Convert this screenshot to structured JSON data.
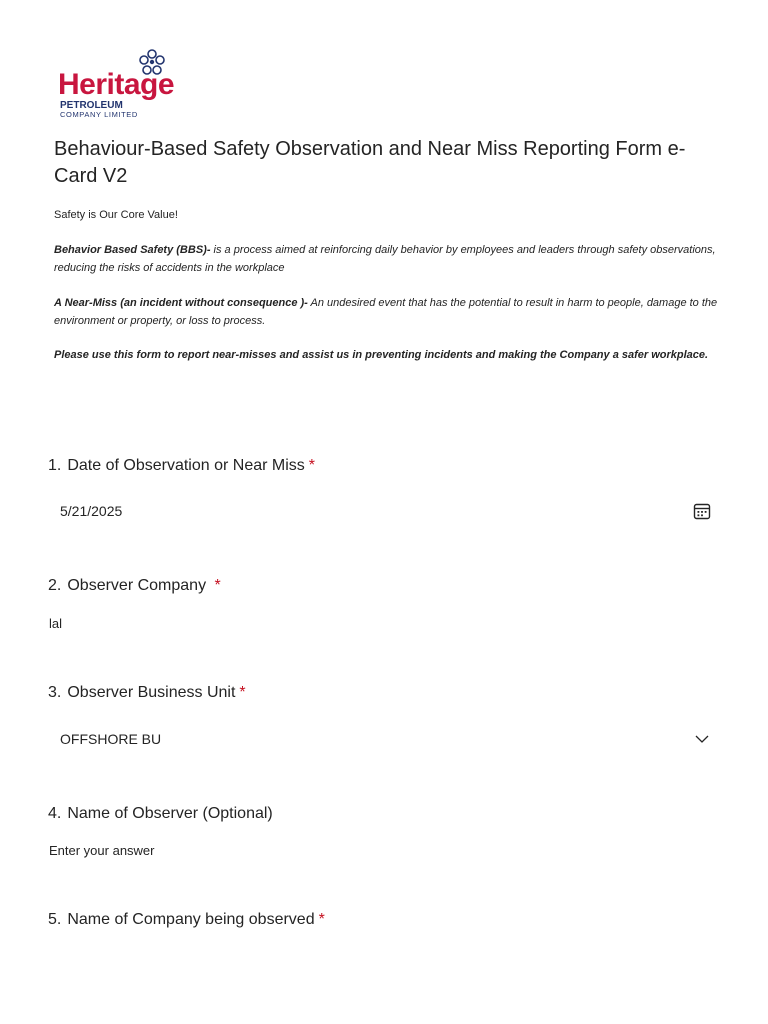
{
  "logo": {
    "brand": "Heritage",
    "line1": "PETROLEUM",
    "line2": "COMPANY LIMITED"
  },
  "form": {
    "title": "Behaviour-Based Safety Observation and Near Miss Reporting Form  e-Card V2",
    "tagline": "Safety is Our Core Value!",
    "bbs_label": "Behavior Based Safety (BBS)-",
    "bbs_text": " is a process aimed at reinforcing daily behavior by employees and leaders through safety observations, reducing the risks of accidents in the workplace",
    "nearmiss_label": "A Near-Miss (an incident without consequence )-",
    "nearmiss_text": " An undesired event that has the potential to result in harm to people, damage to the environment or property, or loss to process.",
    "instruction": "Please use this form to report near-misses and assist us in preventing incidents and making the Company a safer workplace."
  },
  "questions": [
    {
      "num": "1.",
      "label": "Date of Observation or Near Miss",
      "required": "*",
      "value": "5/21/2025",
      "icon": "calendar-icon"
    },
    {
      "num": "2.",
      "label": "Observer Company ",
      "required": "*",
      "value": "lal"
    },
    {
      "num": "3.",
      "label": "Observer Business Unit",
      "required": "*",
      "value": "OFFSHORE BU",
      "icon": "chevron-down-icon"
    },
    {
      "num": "4.",
      "label": "Name of Observer (Optional)",
      "required": "",
      "placeholder": "Enter your answer"
    },
    {
      "num": "5.",
      "label": "Name of Company being observed",
      "required": "*"
    }
  ],
  "colors": {
    "brand_red": "#c8163f",
    "brand_navy": "#22346e",
    "required": "#c50f1f",
    "text": "#242424"
  }
}
